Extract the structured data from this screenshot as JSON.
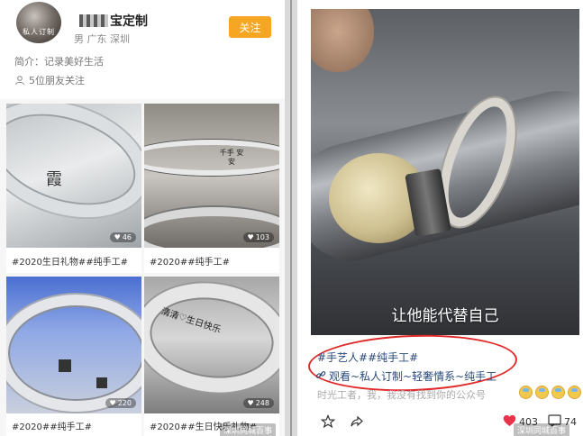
{
  "left": {
    "profile": {
      "avatar_text": "私人订制",
      "name": "宝定制",
      "meta": "男 广东 深圳",
      "follow_label": "关注",
      "bio": "简介：记录美好生活",
      "friends": "5位朋友关注"
    },
    "cards": [
      {
        "caption": "#2020生日礼物##纯手工#",
        "likes": "46",
        "engraving": "霞"
      },
      {
        "caption": "#2020##纯手工#",
        "likes": "103",
        "engraving": "千手 安安"
      },
      {
        "caption": "#2020##纯手工#",
        "likes": "220",
        "engraving": ""
      },
      {
        "caption": "#2020##生日快乐礼物#",
        "likes": "248",
        "engraving": "清清♡生日快乐"
      }
    ]
  },
  "right": {
    "subtitle": "让他能代替自己",
    "tags": "#手艺人##纯手工#",
    "link_text": "观看~私人订制~轻奢情系~纯手工",
    "desc": "时光工者，我，我没有找到你的公众号",
    "emojis": [
      "scared-face-icon",
      "scared-face-icon",
      "scared-face-icon",
      "scared-face-icon"
    ],
    "likes": "403",
    "comments": "74",
    "watermark": "深圳同城百事"
  },
  "left_watermark": "深圳同城百事",
  "colors": {
    "accent": "#f5a623",
    "highlight_oval": "#e02a2a",
    "tag_text": "#2a4a7a",
    "like_heart": "#e8334a"
  }
}
